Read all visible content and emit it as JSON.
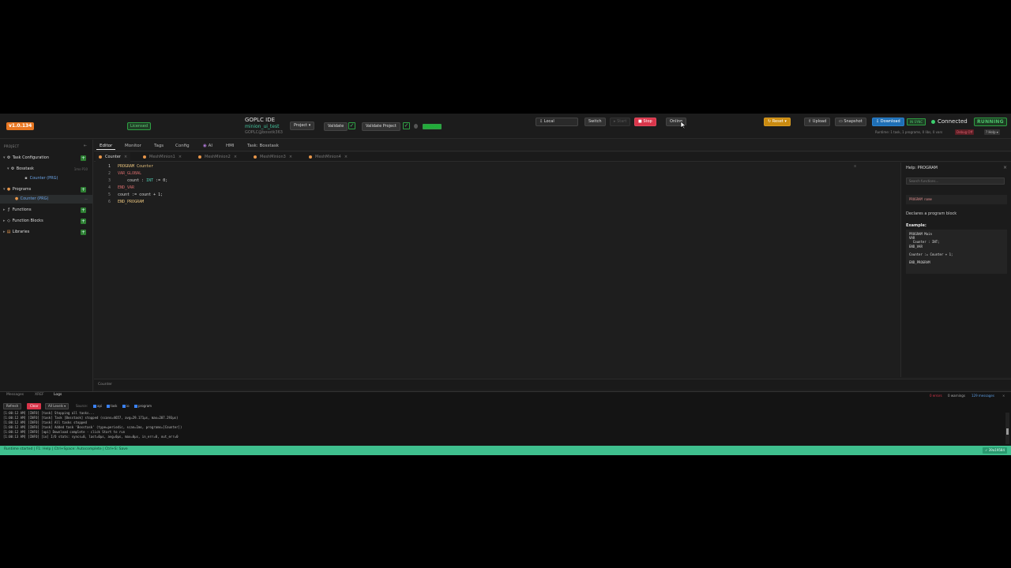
{
  "header": {
    "version": "v1.0.134",
    "licensed": "Licensed",
    "app_title": "GOPLC IDE",
    "project_name": "minion_ui_test",
    "project_sub": "GOPLC@bosstk363",
    "project_btn": "Project ▾",
    "validate_btn": "Validate",
    "validate_project_btn": "Validate Project",
    "hash_badge": "39a19584",
    "target_select": "⇩ Local",
    "switch_btn": "Switch",
    "start_btn": "▸ Start",
    "stop_btn": "■ Stop",
    "online_btn": "Online",
    "reset_btn": "↻ Reset ▾",
    "upload_btn": "⇧ Upload",
    "snapshot_btn": "▭ Snapshot",
    "download_btn": "⇩ Download",
    "insync": "IN SYNC",
    "connected": "Connected",
    "running": "RUNNING",
    "runtime_info": "Runtime: 1 task, 1 programs, 0 libs, 0 vars",
    "debug_off": "Debug Off",
    "help_btn": "? Help ▾"
  },
  "sidebar": {
    "heading": "PROJECT",
    "items": [
      {
        "icon": "⚙",
        "label": "Task Configuration",
        "meta": ""
      },
      {
        "icon": "⚙",
        "label": "Bosstask",
        "meta": "1ms·P10"
      },
      {
        "icon": "▪",
        "label": "Counter (PRG)",
        "meta": ""
      },
      {
        "icon": "●",
        "label": "Programs",
        "meta": ""
      },
      {
        "icon": "●",
        "label": "Counter (PRG)",
        "meta": "—"
      },
      {
        "icon": "ƒ",
        "label": "Functions",
        "meta": ""
      },
      {
        "icon": "◇",
        "label": "Function Blocks",
        "meta": ""
      },
      {
        "icon": "▤",
        "label": "Libraries",
        "meta": ""
      }
    ]
  },
  "main_tabs": [
    "Editor",
    "Monitor",
    "Tags",
    "Config",
    "AI",
    "HMI",
    "Task: Bosstask"
  ],
  "file_tabs": [
    "Counter",
    "MeshMinion1",
    "MeshMinion2",
    "MeshMinion3",
    "MeshMinion4"
  ],
  "editor": {
    "lines": [
      {
        "n": "1",
        "parts": [
          {
            "c": "kw",
            "t": "PROGRAM "
          },
          {
            "c": "kw",
            "t": "Counter"
          }
        ]
      },
      {
        "n": "2",
        "parts": [
          {
            "c": "kw2",
            "t": "VAR_GLOBAL"
          }
        ]
      },
      {
        "n": "3",
        "parts": [
          {
            "c": "tx",
            "t": "    count : "
          },
          {
            "c": "ty",
            "t": "INT"
          },
          {
            "c": "tx",
            "t": " := 0;"
          }
        ]
      },
      {
        "n": "4",
        "parts": [
          {
            "c": "kw2",
            "t": "END_VAR"
          }
        ]
      },
      {
        "n": "5",
        "parts": [
          {
            "c": "tx",
            "t": "count := count + 1;"
          }
        ]
      },
      {
        "n": "6",
        "parts": [
          {
            "c": "kw",
            "t": "END_PROGRAM"
          }
        ]
      }
    ],
    "status": "Counter"
  },
  "help": {
    "title": "Help: PROGRAM",
    "search_placeholder": "Search functions...",
    "syntax": "PROGRAM name",
    "description": "Declares a program block",
    "example_label": "Example:",
    "example_code": "PROGRAM Main\nVAR\n  Counter : INT;\nEND_VAR\n\nCounter := Counter + 1;\n\nEND_PROGRAM"
  },
  "bottom": {
    "tabs": [
      "Messages",
      "XREF",
      "Logs"
    ],
    "errors": "0 errors",
    "warnings": "0 warnings",
    "messages": "129 messages",
    "refresh": "Refresh",
    "clear": "Clear",
    "level": "All Levels ▾",
    "sources_label": "Source:",
    "sources": [
      "api",
      "task",
      "io",
      "program"
    ],
    "logs": "[1:00:12 AM] [INFO] [task] Stopping all tasks...\n[1:00:12 AM] [INFO] [task] Task [Bosstask] stopped (scans=4657, avg=29.171µs, max=207.293µs)\n[1:00:12 AM] [INFO] [task] All tasks stopped\n[1:00:12 AM] [INFO] [task] Added task 'Bosstask' (type=periodic, scan=1ms, programs=[Counter])\n[1:00:12 AM] [INFO] [api] Download complete - click Start to run\n[1:00:13 AM] [INFO] [io] I/O stats: syncs=0, last=0µs, avg=0µs, max=0µs, in_err=0, out_err=0"
  },
  "footer": {
    "text": "Runtime started | F1: Help | Ctrl+Space: Autocomplete | Ctrl+S: Save",
    "hash": "✓ 39a19584"
  }
}
